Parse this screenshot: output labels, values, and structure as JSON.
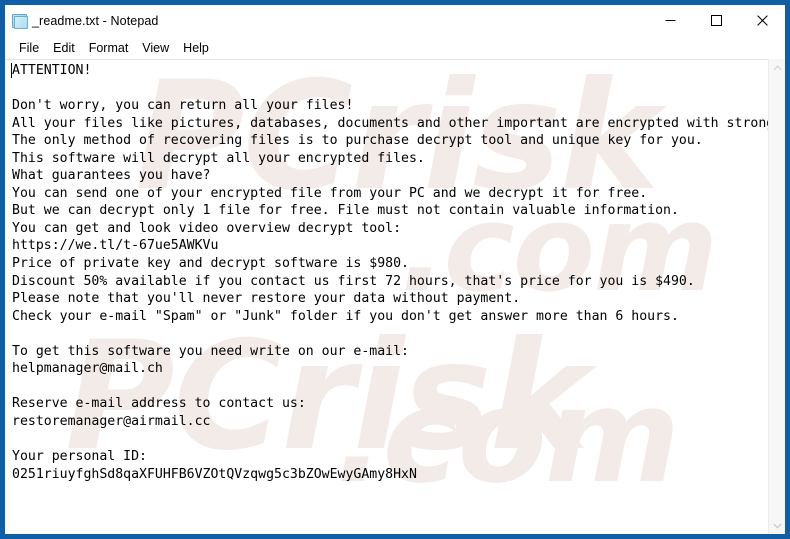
{
  "window": {
    "title": "_readme.txt - Notepad",
    "icon": "notepad-document-icon",
    "frame_color": "#0f5fa6",
    "controls": {
      "minimize": "Minimize",
      "maximize": "Maximize",
      "close": "Close"
    }
  },
  "menu": {
    "items": [
      {
        "label": "File"
      },
      {
        "label": "Edit"
      },
      {
        "label": "Format"
      },
      {
        "label": "View"
      },
      {
        "label": "Help"
      }
    ]
  },
  "document": {
    "filename": "_readme.txt",
    "heading": "ATTENTION!",
    "body": "ATTENTION!\n\nDon't worry, you can return all your files!\nAll your files like pictures, databases, documents and other important are encrypted with strongest encryption and unique key.\nThe only method of recovering files is to purchase decrypt tool and unique key for you.\nThis software will decrypt all your encrypted files.\nWhat guarantees you have?\nYou can send one of your encrypted file from your PC and we decrypt it for free.\nBut we can decrypt only 1 file for free. File must not contain valuable information.\nYou can get and look video overview decrypt tool:\nhttps://we.tl/t-67ue5AWKVu\nPrice of private key and decrypt software is $980.\nDiscount 50% available if you contact us first 72 hours, that's price for you is $490.\nPlease note that you'll never restore your data without payment.\nCheck your e-mail \"Spam\" or \"Junk\" folder if you don't get answer more than 6 hours.\n\nTo get this software you need write on our e-mail:\nhelpmanager@mail.ch\n\nReserve e-mail address to contact us:\nrestoremanager@airmail.cc\n\nYour personal ID:\n0251riuyfghSd8qaXFUHFB6VZOtQVzqwg5c3bZOwEwyGAmy8HxN",
    "details": {
      "video_url": "https://we.tl/t-67ue5AWKVu",
      "price": "$980",
      "discount_price": "$490",
      "discount_percent": "50%",
      "discount_window": "72 hours",
      "response_time": "6 hours",
      "free_files": "1 file",
      "primary_email": "helpmanager@mail.ch",
      "reserve_email": "restoremanager@airmail.cc",
      "personal_id": "0251riuyfghSd8qaXFUHFB6VZOtQVzqwg5c3bZOwEwyGAmy8HxN"
    }
  },
  "watermark": {
    "color": "#f3ebe8",
    "fragments": [
      "PCrisk",
      ".com",
      "PCrisk",
      ".com"
    ]
  },
  "scrollbar": {
    "up_arrow": "chevron-up-icon",
    "down_arrow": "chevron-down-icon"
  }
}
